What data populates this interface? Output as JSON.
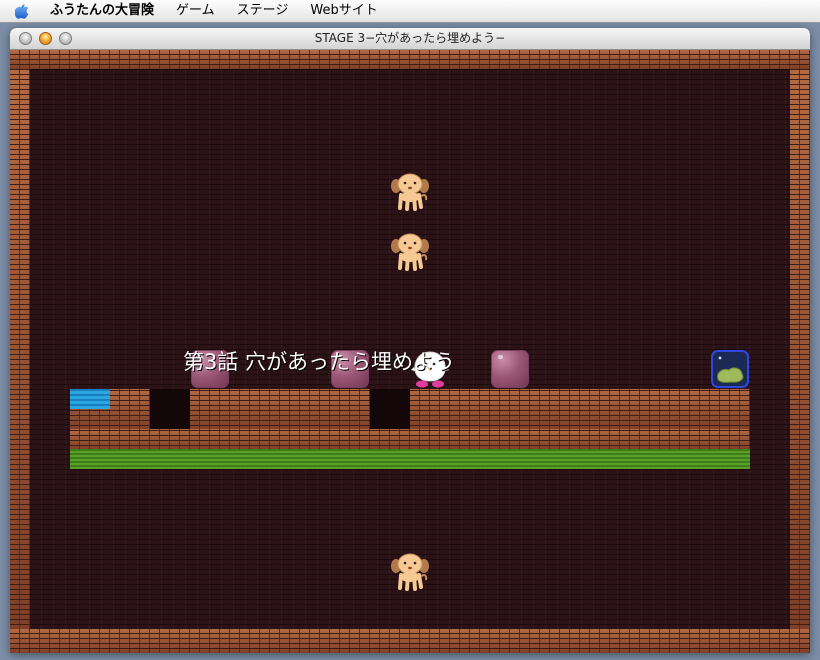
{
  "menubar": {
    "apple_icon": "apple-logo",
    "app_name": "ふうたんの大冒険",
    "items": [
      "ゲーム",
      "ステージ",
      "Webサイト"
    ]
  },
  "window": {
    "title": "STAGE 3−穴があったら埋めよう−"
  },
  "game": {
    "caption": "第3話 穴があったら埋めよう",
    "colors": {
      "brick": "#8a4a30",
      "background_wall": "#2a1216",
      "grass": "#5aa028",
      "water": "#2aa6e0",
      "pink_block": "#9b5876",
      "goal_border": "#2d47e0"
    },
    "sprites": [
      "dog-enemy",
      "dog-enemy",
      "dog-enemy",
      "player-chick",
      "pink-block",
      "pink-block",
      "pink-block",
      "goal-jar"
    ]
  }
}
